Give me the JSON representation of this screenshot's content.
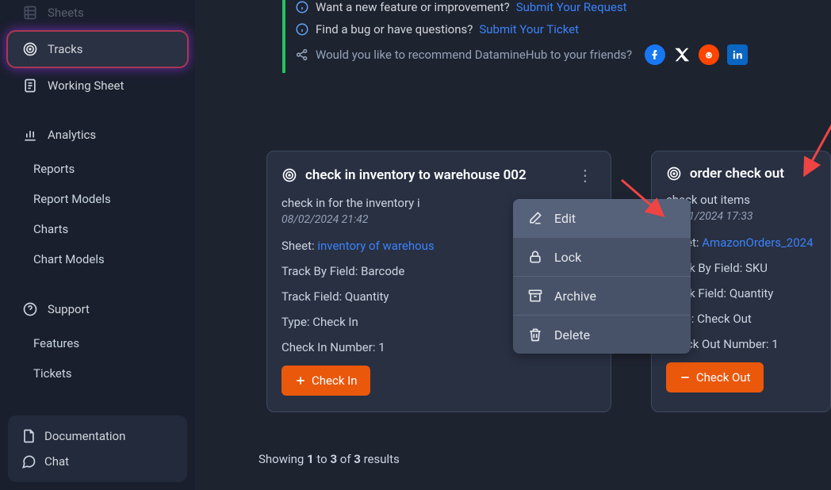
{
  "sidebar": {
    "items": [
      {
        "label": "Sheets"
      },
      {
        "label": "Tracks"
      },
      {
        "label": "Working Sheet"
      },
      {
        "label": "Analytics"
      }
    ],
    "analytics_children": [
      {
        "label": "Reports"
      },
      {
        "label": "Report Models"
      },
      {
        "label": "Charts"
      },
      {
        "label": "Chart Models"
      }
    ],
    "support_label": "Support",
    "support_children": [
      {
        "label": "Features"
      },
      {
        "label": "Tickets"
      }
    ],
    "footer": [
      {
        "label": "Documentation"
      },
      {
        "label": "Chat"
      }
    ]
  },
  "info": {
    "feature_q": "Want a new feature or improvement?",
    "feature_link": "Submit Your Request",
    "bug_q": "Find a bug or have questions?",
    "bug_link": "Submit Your Ticket",
    "share_q": "Would you like to recommend DatamineHub to your friends?"
  },
  "cards": [
    {
      "title": "check in inventory to warehouse 002",
      "desc": "check in for the inventory i",
      "date": "08/02/2024 21:42",
      "sheet_label": "Sheet:",
      "sheet_link": "inventory of warehous",
      "trackby_label": "Track By Field:",
      "trackby_value": "Barcode",
      "trackfield_label": "Track Field:",
      "trackfield_value": "Quantity",
      "type_label": "Type:",
      "type_value": "Check In",
      "num_label": "Check In Number:",
      "num_value": "1",
      "btn": "Check In"
    },
    {
      "title": "order check out",
      "desc": "check out items",
      "date": "07/21/2024 17:33",
      "sheet_label": "Sheet:",
      "sheet_link": "AmazonOrders_2024",
      "trackby_label": "Track By Field:",
      "trackby_value": "SKU",
      "trackfield_label": "Track Field:",
      "trackfield_value": "Quantity",
      "type_label": "Type:",
      "type_value": "Check Out",
      "num_label": "Check Out Number:",
      "num_value": "1",
      "btn": "Check Out"
    }
  ],
  "menu": [
    {
      "label": "Edit"
    },
    {
      "label": "Lock"
    },
    {
      "label": "Archive"
    },
    {
      "label": "Delete"
    }
  ],
  "results": {
    "prefix": "Showing ",
    "a": "1",
    "mid": " to ",
    "b": "3",
    "of": " of ",
    "c": "3",
    "suffix": " results"
  }
}
